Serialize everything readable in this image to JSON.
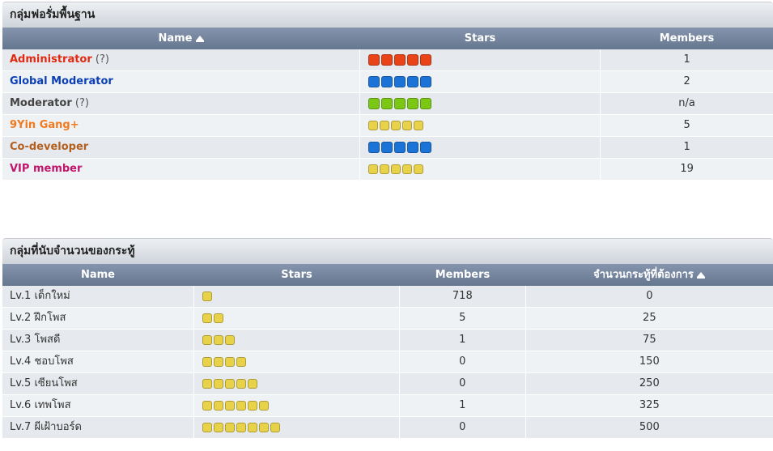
{
  "forum_groups": {
    "title": "กลุ่มฟอรั่มพื้นฐาน",
    "headers": {
      "name": "Name",
      "stars": "Stars",
      "members": "Members"
    },
    "rows": [
      {
        "name": "Administrator",
        "suffix": "(?)",
        "color": "#e02a12",
        "stars": 5,
        "star_color": "#e94418",
        "star_size": "big",
        "members": "1"
      },
      {
        "name": "Global Moderator",
        "suffix": "",
        "color": "#0b3fb4",
        "stars": 5,
        "star_color": "#1b73d8",
        "star_size": "big",
        "members": "2"
      },
      {
        "name": "Moderator",
        "suffix": "(?)",
        "color": "#444444",
        "stars": 5,
        "star_color": "#7ac716",
        "star_size": "big",
        "members": "n/a"
      },
      {
        "name": "9Yin Gang+",
        "suffix": "",
        "color": "#f07a20",
        "stars": 5,
        "star_color": "#e8d24a",
        "star_size": "small",
        "members": "5"
      },
      {
        "name": "Co-developer",
        "suffix": "",
        "color": "#b25f1f",
        "stars": 5,
        "star_color": "#1b73d8",
        "star_size": "big",
        "members": "1"
      },
      {
        "name": "VIP member",
        "suffix": "",
        "color": "#c0166b",
        "stars": 5,
        "star_color": "#e8d24a",
        "star_size": "small",
        "members": "19"
      }
    ]
  },
  "post_groups": {
    "title": "กลุ่มที่นับจำนวนของกระทู้",
    "headers": {
      "name": "Name",
      "stars": "Stars",
      "members": "Members",
      "required_posts": "จำนวนกระทู้ที่ต้องการ"
    },
    "star_color": "#e8d24a",
    "rows": [
      {
        "name": "Lv.1 เด็กใหม่",
        "stars": 1,
        "members": "718",
        "required_posts": "0"
      },
      {
        "name": "Lv.2 ฝึกโพส",
        "stars": 2,
        "members": "5",
        "required_posts": "25"
      },
      {
        "name": "Lv.3 โพสดี",
        "stars": 3,
        "members": "1",
        "required_posts": "75"
      },
      {
        "name": "Lv.4 ชอบโพส",
        "stars": 4,
        "members": "0",
        "required_posts": "150"
      },
      {
        "name": "Lv.5 เซียนโพส",
        "stars": 5,
        "members": "0",
        "required_posts": "250"
      },
      {
        "name": "Lv.6 เทพโพส",
        "stars": 6,
        "members": "1",
        "required_posts": "325"
      },
      {
        "name": "Lv.7 ผีเฝ้าบอร์ด",
        "stars": 7,
        "members": "0",
        "required_posts": "500"
      }
    ]
  }
}
